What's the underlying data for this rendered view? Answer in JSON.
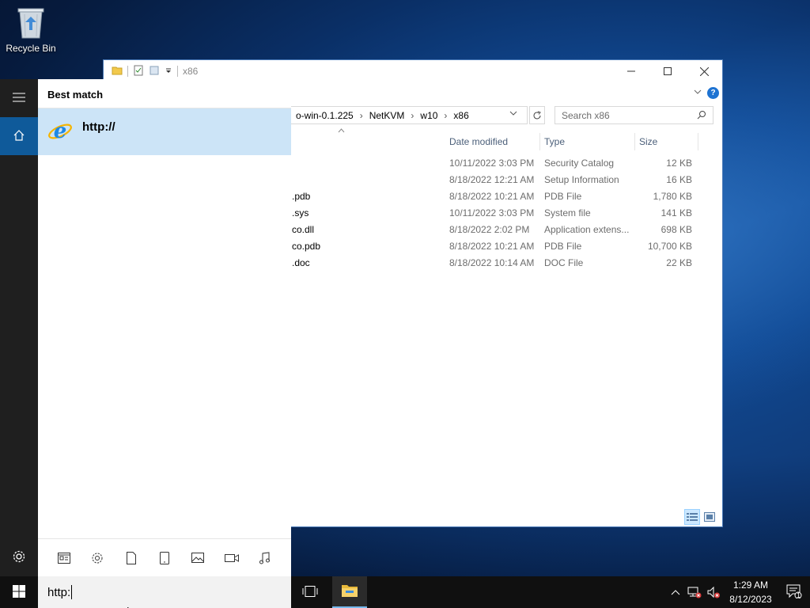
{
  "desktop": {
    "recycle_bin_label": "Recycle Bin"
  },
  "explorer": {
    "title": "x86",
    "breadcrumb": [
      "o-win-0.1.225",
      "NetKVM",
      "w10",
      "x86"
    ],
    "search_placeholder": "Search x86",
    "columns": {
      "date": "Date modified",
      "type": "Type",
      "size": "Size"
    },
    "files": [
      {
        "name": "",
        "date": "10/11/2022 3:03 PM",
        "type": "Security Catalog",
        "size": "12 KB"
      },
      {
        "name": "",
        "date": "8/18/2022 12:21 AM",
        "type": "Setup Information",
        "size": "16 KB"
      },
      {
        "name": ".pdb",
        "date": "8/18/2022 10:21 AM",
        "type": "PDB File",
        "size": "1,780 KB"
      },
      {
        "name": ".sys",
        "date": "10/11/2022 3:03 PM",
        "type": "System file",
        "size": "141 KB"
      },
      {
        "name": "co.dll",
        "date": "8/18/2022 2:02 PM",
        "type": "Application extens...",
        "size": "698 KB"
      },
      {
        "name": "co.pdb",
        "date": "8/18/2022 10:21 AM",
        "type": "PDB File",
        "size": "10,700 KB"
      },
      {
        "name": ".doc",
        "date": "8/18/2022 10:14 AM",
        "type": "DOC File",
        "size": "22 KB"
      }
    ]
  },
  "start": {
    "best_match_header": "Best match",
    "best_match_item": "http://",
    "filters": [
      "apps-icon",
      "settings-icon",
      "documents-icon",
      "tablet-icon",
      "photos-icon",
      "videos-icon",
      "music-icon"
    ]
  },
  "taskbar": {
    "search_value": "http:",
    "time": "1:29 AM",
    "date": "8/12/2023",
    "notification_count": "1"
  },
  "colors": {
    "accent": "#0f5a9a",
    "selection": "#cce4f7",
    "taskbar": "#101010"
  }
}
